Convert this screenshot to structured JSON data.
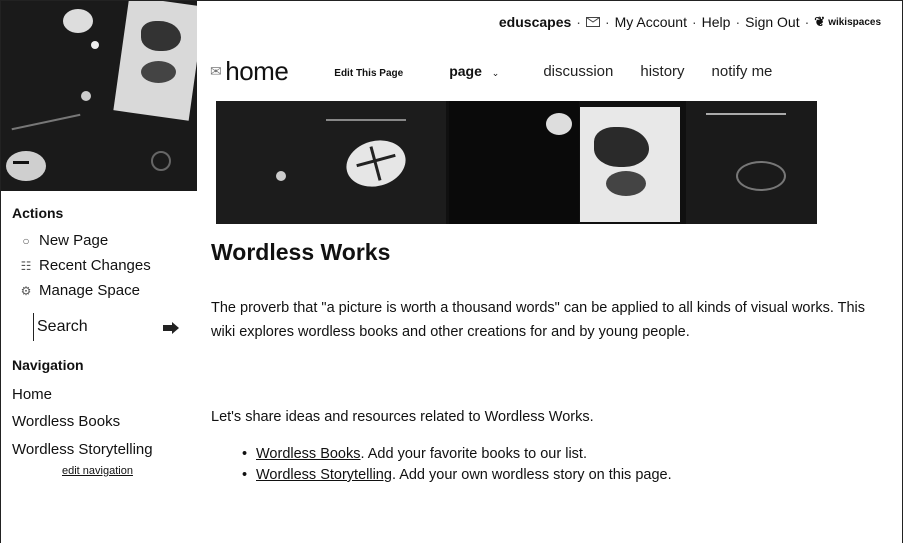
{
  "header": {
    "space_name": "eduscapes",
    "my_account": "My Account",
    "help": "Help",
    "sign_out": "Sign Out",
    "brand": "wikispaces"
  },
  "pagebar": {
    "page_name": "home",
    "edit_this_page": "Edit This Page",
    "page_tab": "page",
    "tabs": [
      "discussion",
      "history",
      "notify me"
    ]
  },
  "sidebar": {
    "actions_heading": "Actions",
    "actions": [
      {
        "label": "New Page",
        "icon": "new-page-icon"
      },
      {
        "label": "Recent Changes",
        "icon": "recent-changes-icon"
      },
      {
        "label": "Manage Space",
        "icon": "manage-space-icon"
      }
    ],
    "search_label": "Search",
    "navigation_heading": "Navigation",
    "nav_items": [
      "Home",
      "Wordless Books",
      "Wordless Storytelling"
    ],
    "edit_navigation": "edit navigation"
  },
  "main": {
    "title": "Wordless Works",
    "paragraph1": "The proverb that \"a picture is worth a thousand words\" can be applied to all kinds of visual works. This wiki explores wordless books and other creations for and by young people.",
    "paragraph2": "Let's share ideas and resources related to Wordless Works.",
    "bullets": [
      {
        "link": "Wordless Books",
        "text": ". Add your favorite books to our list."
      },
      {
        "link": "Wordless Storytelling",
        "text": ". Add your own wordless story on this page."
      }
    ]
  }
}
